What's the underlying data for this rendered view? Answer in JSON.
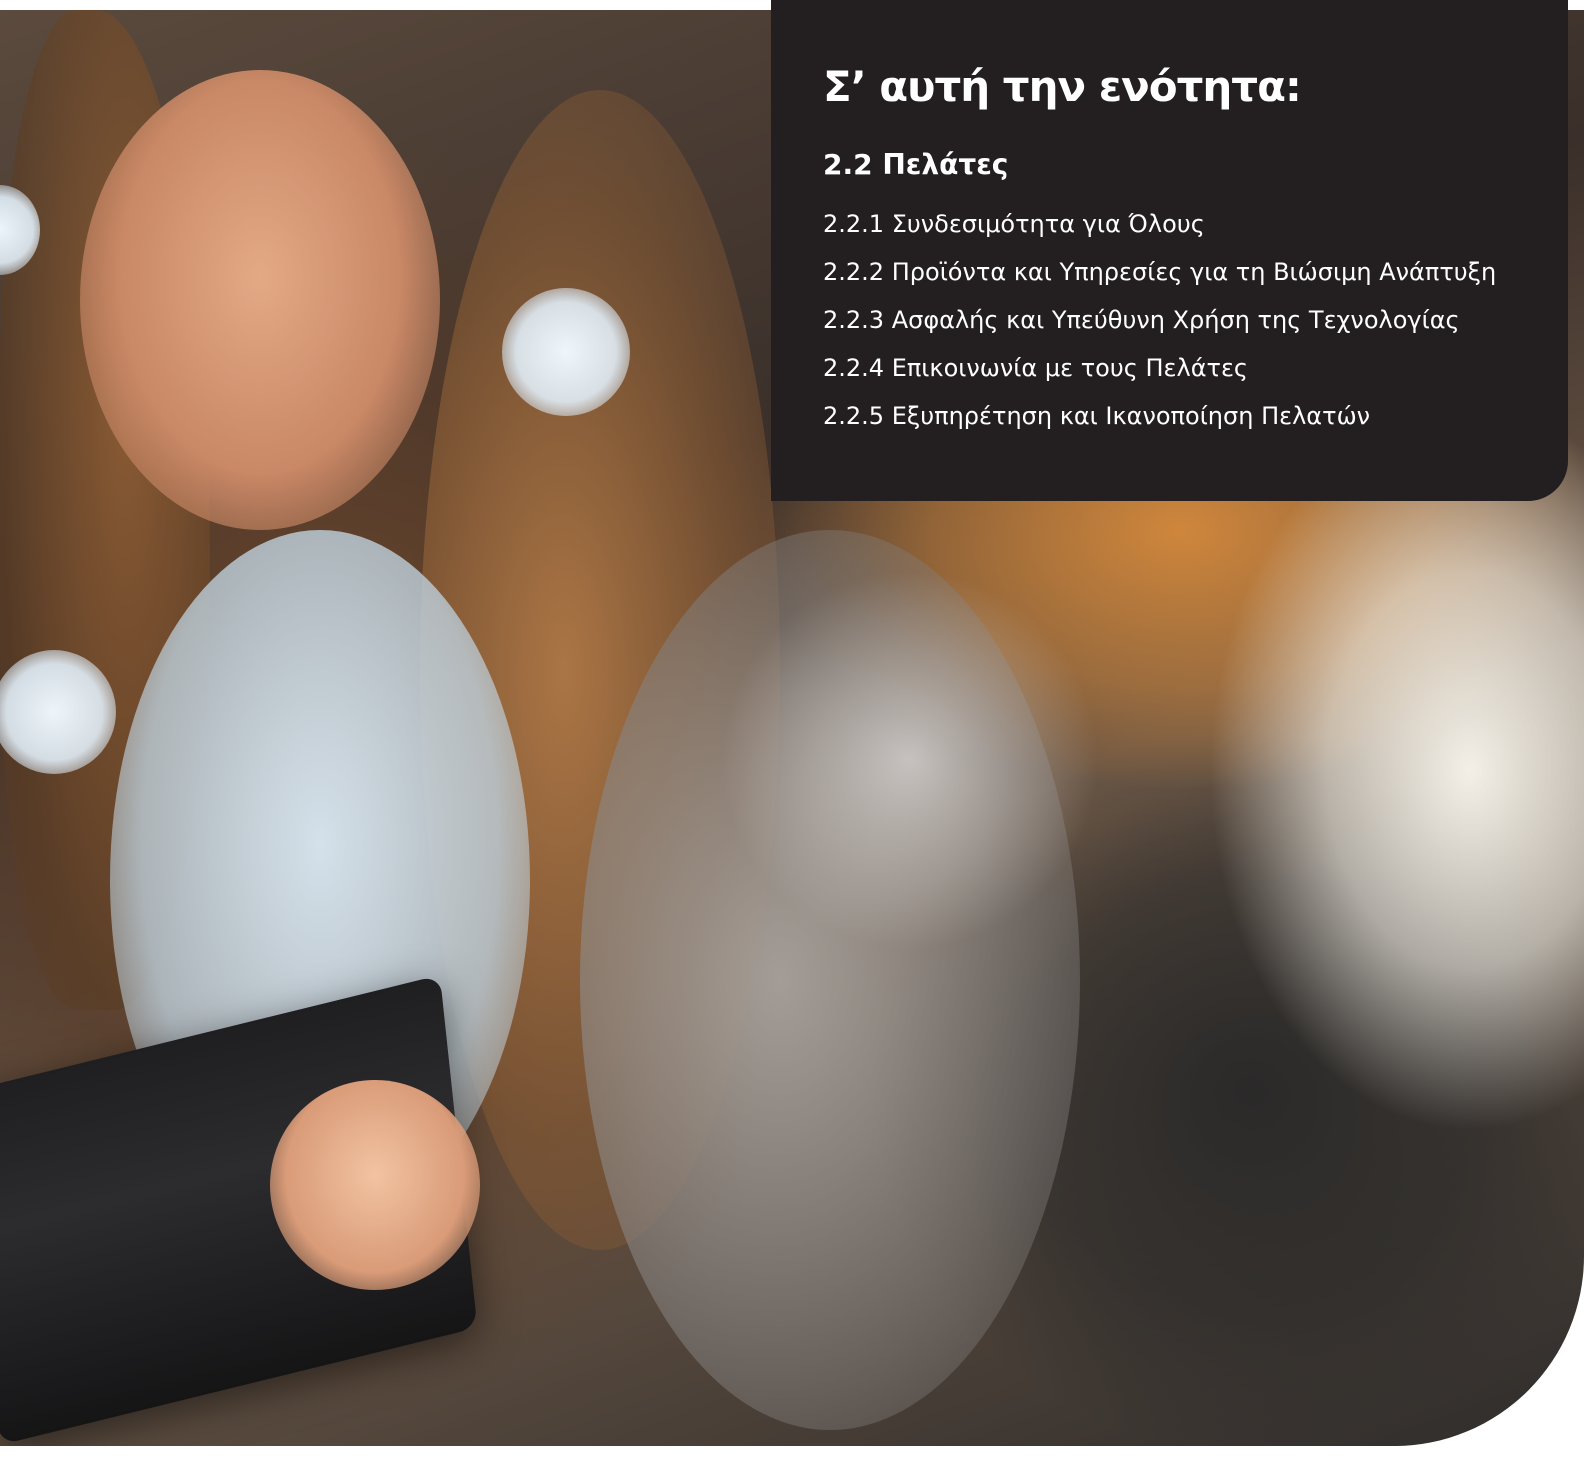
{
  "panel": {
    "title": "Σ’ αυτή την ενότητα:",
    "section_heading": "2.2 Πελάτες",
    "items": [
      {
        "label": "2.2.1 Συνδεσιμότητα για Όλους"
      },
      {
        "label": "2.2.2 Προϊόντα και Υπηρεσίες για τη Βιώσιμη Ανάπτυξη"
      },
      {
        "label": "2.2.3 Ασφαλής και Υπεύθυνη Χρήση της Τεχνολογίας"
      },
      {
        "label": "2.2.4 Επικοινωνία με τους Πελάτες"
      },
      {
        "label": "2.2.5 Εξυπηρέτηση και Ικανοποίηση Πελατών"
      }
    ],
    "background_color": "#231f20",
    "text_color": "#ffffff"
  },
  "photo": {
    "subject_icon": "woman-with-tablet-photo"
  }
}
